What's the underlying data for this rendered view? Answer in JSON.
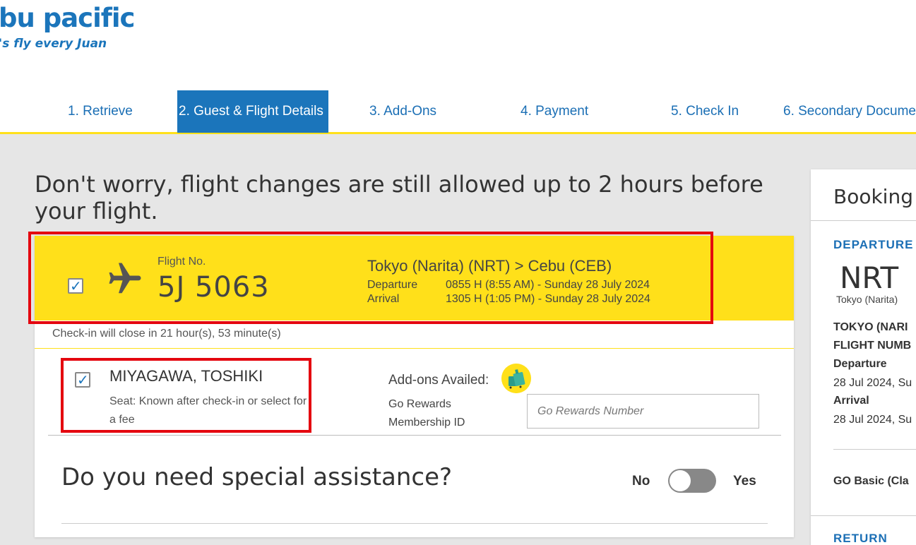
{
  "brand": {
    "logo_text": "bu pacific",
    "tagline": "'s fly every Juan",
    "color": "#1b75bb",
    "accent": "#ffe01a"
  },
  "steps": [
    {
      "label": "1. Retrieve",
      "active": false
    },
    {
      "label": "2. Guest & Flight Details",
      "active": true
    },
    {
      "label": "3. Add-Ons",
      "active": false
    },
    {
      "label": "4. Payment",
      "active": false
    },
    {
      "label": "5. Check In",
      "active": false
    },
    {
      "label": "6. Secondary Docume",
      "active": false
    }
  ],
  "headline": "Don't worry, flight changes are still allowed up to 2 hours before your flight.",
  "flight": {
    "checked": true,
    "icon": "plane-icon",
    "flight_no_label": "Flight No.",
    "flight_no": "5J 5063",
    "route": "Tokyo (Narita) (NRT) > Cebu (CEB)",
    "departure_label": "Departure",
    "departure_value": "0855 H (8:55 AM) - Sunday 28 July 2024",
    "arrival_label": "Arrival",
    "arrival_value": "1305 H (1:05 PM) - Sunday 28 July 2024",
    "checkin_close": "Check-in will close in 21 hour(s), 53 minute(s)"
  },
  "passenger": {
    "checked": true,
    "name": "MIYAGAWA, TOSHIKI",
    "seat": "Seat: Known after check-in or select for a fee",
    "addons_label": "Add-ons Availed:",
    "addon_icon": "baggage-icon",
    "go_rewards_label": "Go Rewards Membership ID",
    "go_rewards_placeholder": "Go Rewards Number",
    "go_rewards_value": ""
  },
  "assistance": {
    "question": "Do you need special assistance?",
    "no_label": "No",
    "yes_label": "Yes",
    "value": "No"
  },
  "sidebar": {
    "title": "Booking S",
    "departure_heading": "DEPARTURE",
    "origin_code": "NRT",
    "origin_city": "Tokyo (Narita)",
    "route_text": "TOKYO (NARI",
    "flight_number_text": "FLIGHT NUMB",
    "departure_label": "Departure",
    "departure_date": "28 Jul 2024, Su",
    "arrival_label": "Arrival",
    "arrival_date": "28 Jul 2024, Su",
    "fare": "GO Basic (Cla",
    "return_heading": "RETURN"
  }
}
